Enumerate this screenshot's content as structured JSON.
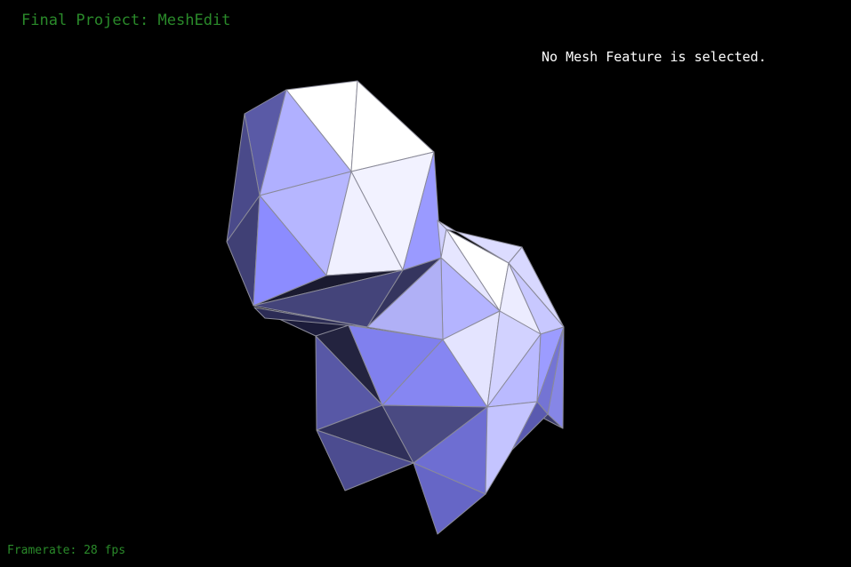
{
  "app": {
    "title": "Final Project: MeshEdit",
    "selection_status": "No Mesh Feature is selected.",
    "framerate_label": "Framerate: 28 fps"
  },
  "viewport": {
    "background": "#000000",
    "hud_text_color": "#2a8a2a",
    "status_text_color": "#ffffff",
    "mesh_edge_color": "#8a8a98",
    "mesh_base_color": "#8a8aff"
  }
}
